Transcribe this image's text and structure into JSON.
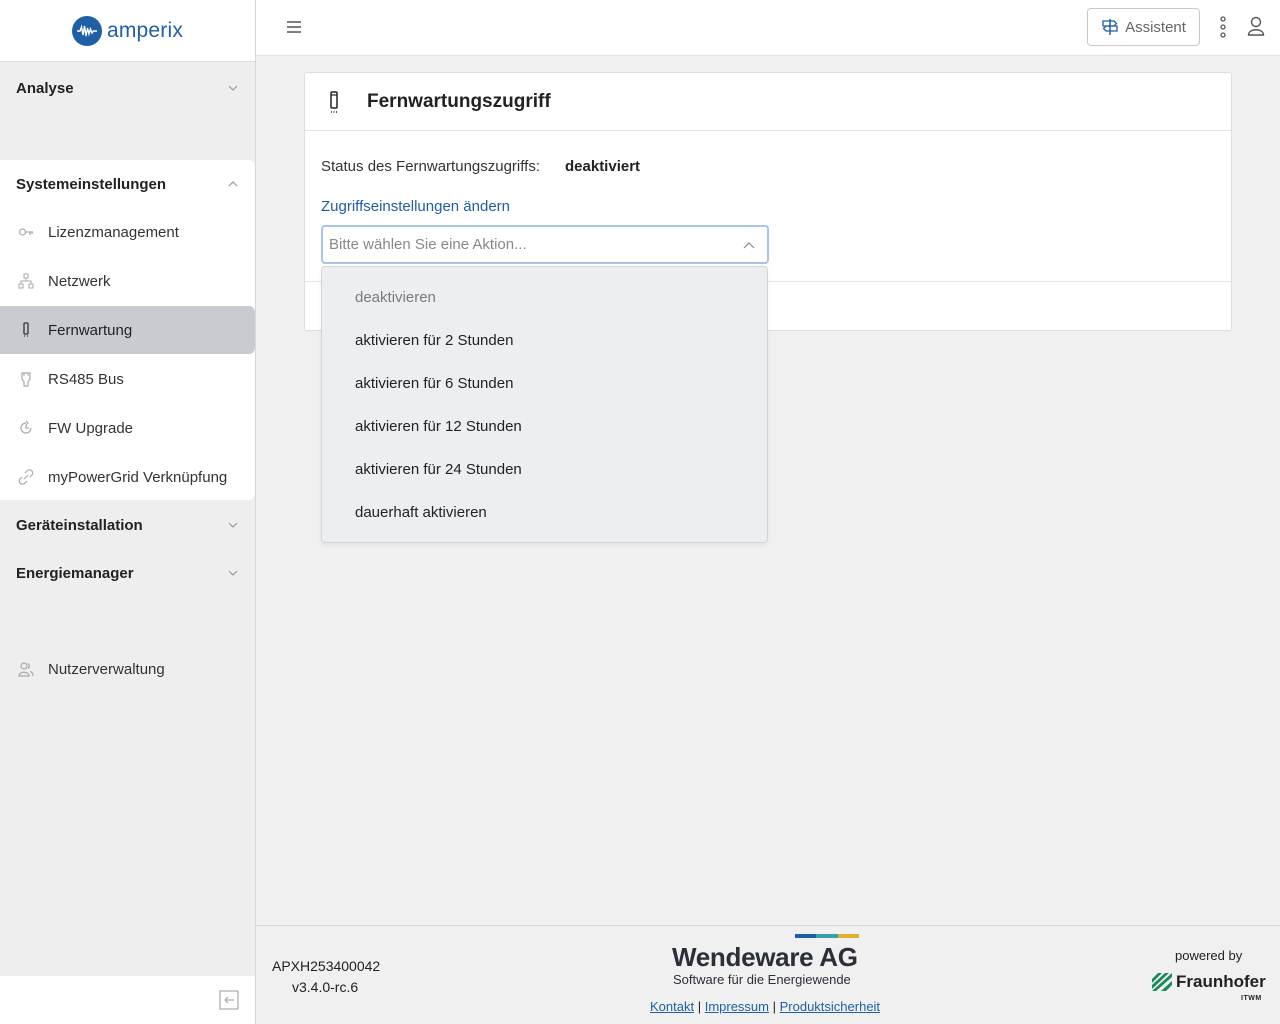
{
  "brand": {
    "name": "amperix",
    "color": "#1f5fa6"
  },
  "sidebar": {
    "groups": [
      {
        "label": "Analyse",
        "expanded": false
      },
      {
        "label": "Systemeinstellungen",
        "expanded": true
      },
      {
        "label": "Geräteinstallation",
        "expanded": false
      },
      {
        "label": "Energiemanager",
        "expanded": false
      }
    ],
    "sub_items": [
      {
        "label": "Lizenzmanagement",
        "icon": "key-icon"
      },
      {
        "label": "Netzwerk",
        "icon": "network-icon"
      },
      {
        "label": "Fernwartung",
        "icon": "remote-icon",
        "active": true
      },
      {
        "label": "RS485 Bus",
        "icon": "plug-icon"
      },
      {
        "label": "FW Upgrade",
        "icon": "refresh-icon"
      },
      {
        "label": "myPowerGrid Verknüpfung",
        "icon": "link-icon"
      }
    ],
    "user_mgmt": {
      "label": "Nutzerverwaltung",
      "icon": "users-icon"
    }
  },
  "topbar": {
    "assistant_label": "Assistent"
  },
  "card": {
    "title": "Fernwartungszugriff",
    "status_label": "Status des Fernwartungszugriffs:",
    "status_value": "deaktiviert",
    "change_link": "Zugriffseinstellungen ändern",
    "select_placeholder": "Bitte wählen Sie eine Aktion..."
  },
  "dropdown": {
    "options": [
      {
        "label": "deaktivieren",
        "disabled": true
      },
      {
        "label": "aktivieren für 2 Stunden"
      },
      {
        "label": "aktivieren für 6 Stunden"
      },
      {
        "label": "aktivieren für 12 Stunden"
      },
      {
        "label": "aktivieren für 24 Stunden"
      },
      {
        "label": "dauerhaft aktivieren"
      }
    ]
  },
  "footer": {
    "serial": "APXH253400042",
    "version": "v3.4.0-rc.6",
    "company": "Wendeware AG",
    "tagline": "Software für die Energiewende",
    "links": [
      "Kontakt",
      "Impressum",
      "Produktsicherheit"
    ],
    "powered_by": "powered by",
    "partner": "Fraunhofer",
    "partner_sub": "ITWM"
  }
}
